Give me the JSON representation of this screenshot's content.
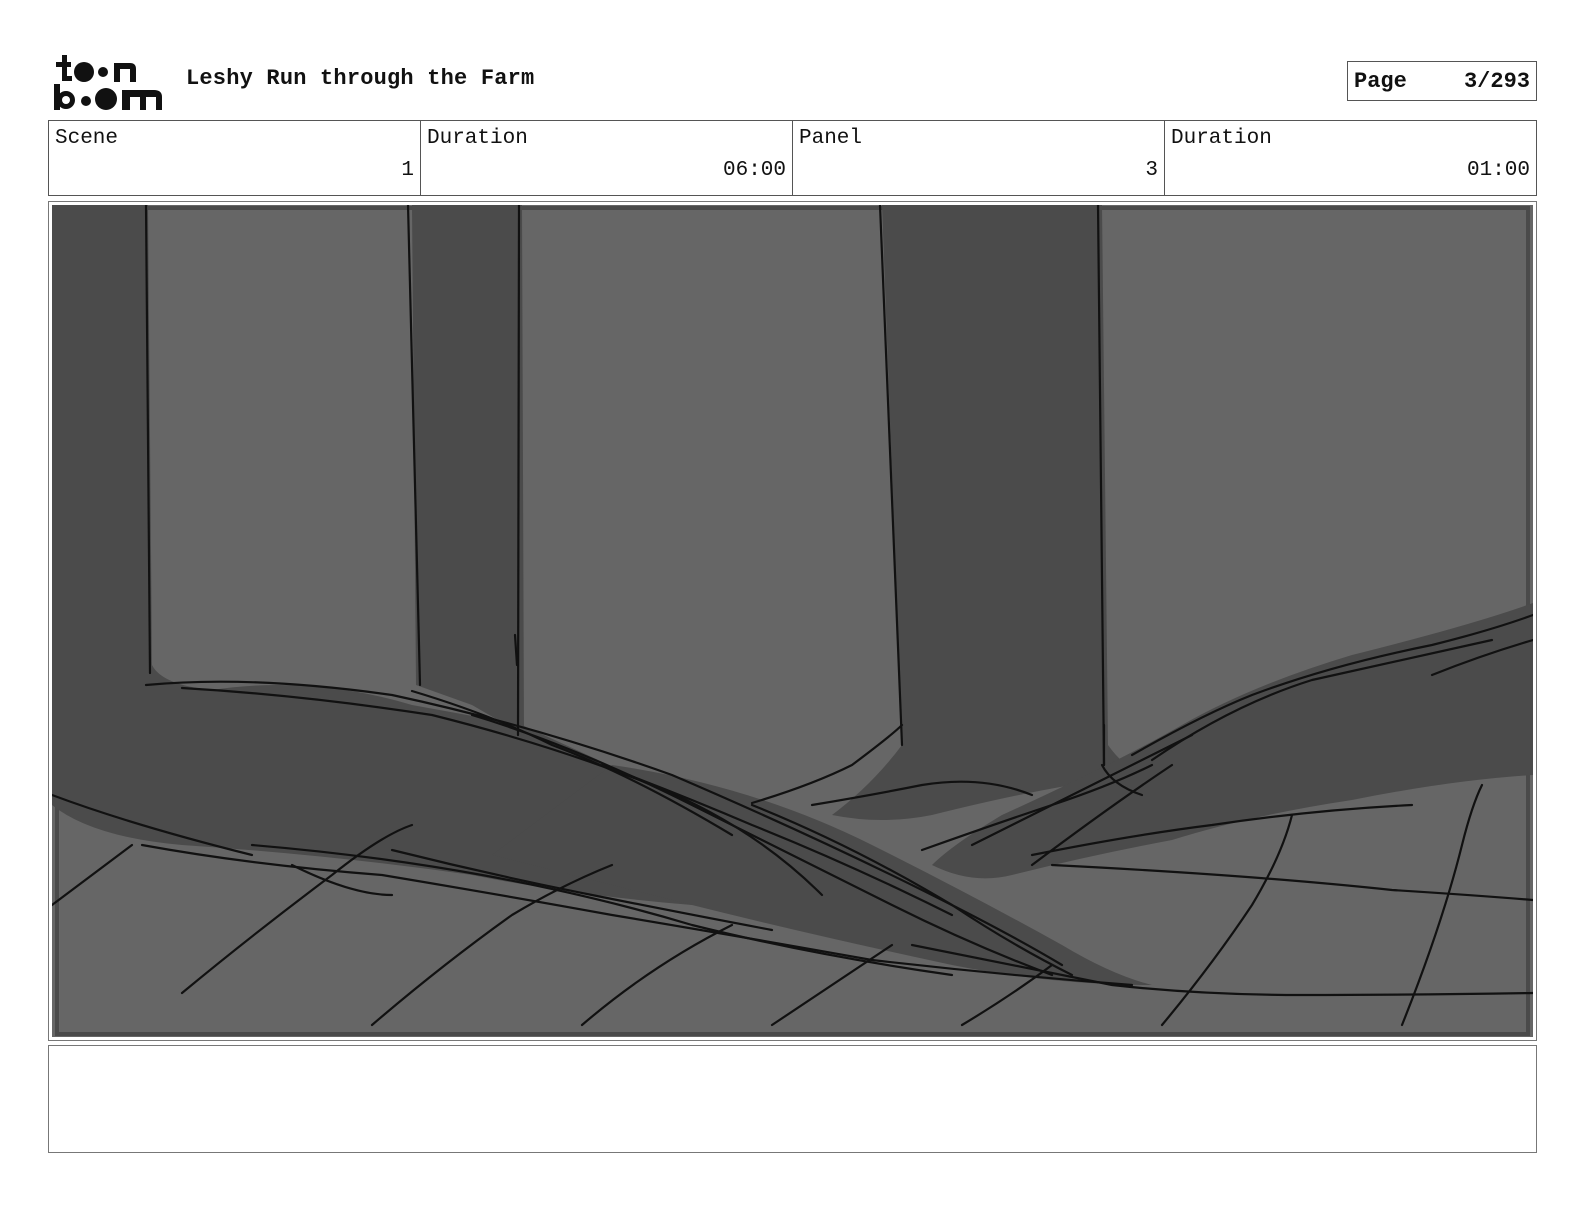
{
  "header": {
    "logo_alt": "toon boom",
    "title": "Leshy Run through the Farm",
    "page_label": "Page",
    "page_value": "3/293"
  },
  "info": [
    {
      "label": "Scene",
      "value": "1"
    },
    {
      "label": "Duration",
      "value": "06:00"
    },
    {
      "label": "Panel",
      "value": "3"
    },
    {
      "label": "Duration",
      "value": "01:00"
    }
  ],
  "panel": {
    "colors": {
      "background": "#666666",
      "shadow": "#4b4b4b",
      "ink": "#111111"
    }
  },
  "notes": {
    "text": ""
  }
}
